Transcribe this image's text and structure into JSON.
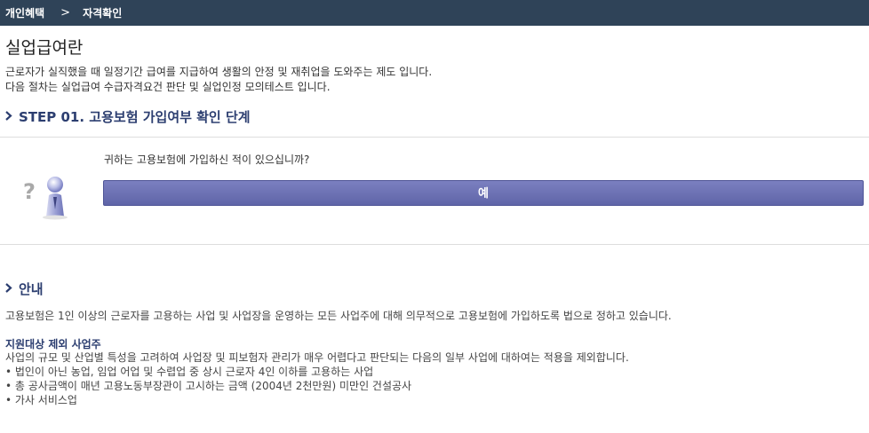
{
  "breadcrumb": {
    "items": [
      "개인혜택",
      "자격확인"
    ],
    "separator": ">"
  },
  "page": {
    "title": "실업급여란",
    "description": [
      "근로자가 실직했을 때 일정기간 급여를 지급하여 생활의 안정 및 재취업을 도와주는 제도 입니다.",
      "다음 절차는 실업급여 수급자격요건 판단 및 실업인정 모의테스트 입니다."
    ]
  },
  "step": {
    "title": "STEP 01. 고용보험 가입여부 확인 단계",
    "question": "귀하는 고용보험에 가입하신 적이 있으십니까?",
    "yes_label": "예",
    "icon": "question-person-icon"
  },
  "info": {
    "title": "안내",
    "intro": "고용보험은 1인 이상의 근로자를 고용하는 사업 및 사업장을 운영하는 모든 사업주에 대해 의무적으로 고용보험에 가입하도록 법으로 정하고 있습니다.",
    "subheading": "지원대상 제외 사업주",
    "lines": [
      "사업의 규모 및 산업별 특성을 고려하여 사업장 및 피보험자 관리가 매우 어렵다고 판단되는 다음의 일부 사업에 대하여는 적용을 제외합니다.",
      "• 법인이 아닌 농업, 임업 어업 및 수렵업 중 상시 근로자 4인 이하를 고용하는 사업",
      "• 총 공사금액이 매년 고용노동부장관이 고시하는 금액 (2004년 2천만원) 미만인 건설공사",
      "• 가사 서비스업"
    ]
  },
  "colors": {
    "topbar": "#2f4358",
    "accent": "#2c3e70",
    "button": "#6a70b3",
    "divider": "#dddddd"
  }
}
